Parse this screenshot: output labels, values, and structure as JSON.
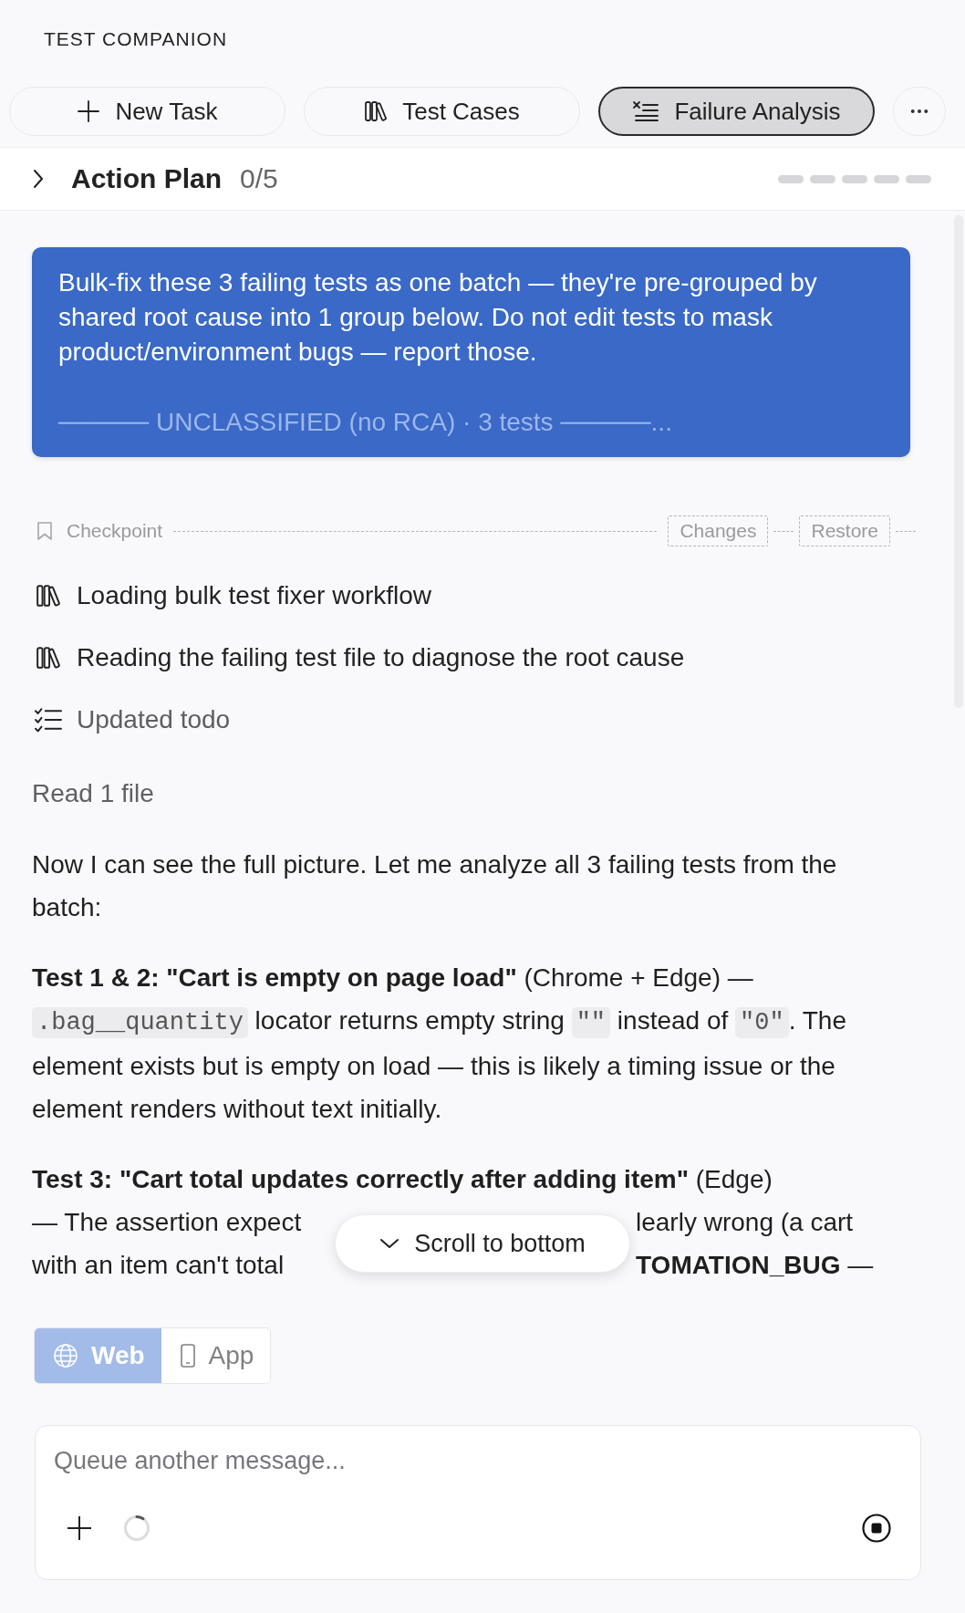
{
  "app": {
    "title": "TEST COMPANION"
  },
  "tabs": [
    {
      "label": "New Task",
      "kind": "create",
      "selected": false
    },
    {
      "label": "Test Cases",
      "kind": "library",
      "selected": false
    },
    {
      "label": "Failure Analysis",
      "kind": "analysis",
      "selected": true
    }
  ],
  "action_plan": {
    "title": "Action Plan",
    "count": "0/5",
    "expanded": false,
    "steps": [
      {
        "done": false
      },
      {
        "done": false
      },
      {
        "done": false
      },
      {
        "done": false
      },
      {
        "done": false
      }
    ]
  },
  "banner": {
    "text": "Bulk-fix these 3 failing tests as one batch — they're pre-grouped by shared root cause into 1 group below. Do not edit tests to mask product/environment bugs — report those.",
    "group_line": "───── UNCLASSIFIED (no RCA) · 3 tests ─────..."
  },
  "checkpoint": {
    "label": "Checkpoint",
    "actions": [
      "Changes",
      "Restore"
    ]
  },
  "activity": [
    {
      "kind": "skill",
      "text": "Loading bulk test fixer workflow"
    },
    {
      "kind": "skill",
      "text": "Reading the failing test file to diagnose the root cause"
    },
    {
      "kind": "todo",
      "text": "Updated todo"
    }
  ],
  "status_line": "Read 1 file",
  "message": {
    "paragraphs": [
      {
        "runs": [
          {
            "kind": "text",
            "text": "Now I can see the full picture. Let me analyze all 3 failing tests from the batch:"
          }
        ]
      },
      {
        "runs": [
          {
            "kind": "text",
            "text": "**Test 1 & 2: \"Cart is empty on page load\"** (Chrome + Edge) — "
          },
          {
            "kind": "code",
            "text": ".bag__quantity"
          },
          {
            "kind": "text",
            "text": " locator returns empty string "
          },
          {
            "kind": "code",
            "text": "\"\""
          },
          {
            "kind": "text",
            "text": " instead of "
          },
          {
            "kind": "code",
            "text": "\"0\""
          },
          {
            "kind": "text",
            "text": ". The element exists but is empty on load — this is likely a timing issue or the element renders without text initially."
          }
        ]
      }
    ],
    "covered_paragraph": {
      "first_line": "**Test 3: \"Cart total updates correctly after adding item\"** (Edge)",
      "left": [
        "— The assertion expect",
        "with an item can't total"
      ],
      "right": [
        "learly wrong (a cart",
        "**TOMATION_BUG** —"
      ]
    }
  },
  "scroll_to_bottom": {
    "label": "Scroll to bottom"
  },
  "platforms": [
    {
      "label": "Web",
      "kind": "web",
      "selected": true
    },
    {
      "label": "App",
      "kind": "app",
      "selected": false
    }
  ],
  "composer": {
    "placeholder": "Queue another message...",
    "running": true
  }
}
